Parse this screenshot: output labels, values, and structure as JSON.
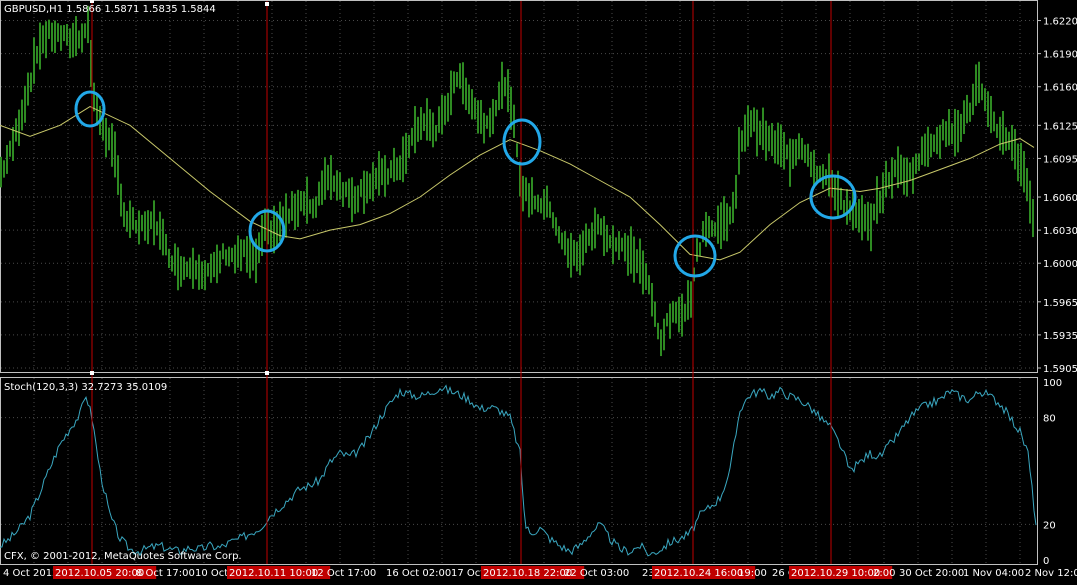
{
  "main_header": "GBPUSD,H1  1.5866 1.5871 1.5835 1.5844",
  "stoch_header": "Stoch(120,3,3) 32.7273 35.0109",
  "copyright": "CFX, © 2001-2012, MetaQuotes Software Corp.",
  "colors": {
    "background": "#000000",
    "grid": "#4a4a4a",
    "border": "#c0c0c0",
    "candle": "#2e8b22",
    "ma": "#c8c86a",
    "stoch": "#3aa7c0",
    "vline": "#c00000",
    "circle": "#22a8e8",
    "label_highlight": "#c00000"
  },
  "chart_data": [
    {
      "type": "line",
      "name": "GBPUSD,H1",
      "y_ticks": [
        "1.6220",
        "1.6190",
        "1.6160",
        "1.6125",
        "1.6095",
        "1.6060",
        "1.6030",
        "1.6000",
        "1.5965",
        "1.5935",
        "1.5905"
      ],
      "ylim": [
        1.5905,
        1.6235
      ],
      "price_path": [
        [
          0,
          1.608
        ],
        [
          10,
          1.61
        ],
        [
          20,
          1.613
        ],
        [
          30,
          1.6165
        ],
        [
          40,
          1.62
        ],
        [
          50,
          1.6208
        ],
        [
          60,
          1.6206
        ],
        [
          70,
          1.6202
        ],
        [
          80,
          1.6206
        ],
        [
          88,
          1.6215
        ],
        [
          95,
          1.614
        ],
        [
          105,
          1.612
        ],
        [
          115,
          1.6095
        ],
        [
          125,
          1.604
        ],
        [
          135,
          1.6035
        ],
        [
          145,
          1.603
        ],
        [
          155,
          1.604
        ],
        [
          165,
          1.6015
        ],
        [
          175,
          1.6
        ],
        [
          185,
          1.5995
        ],
        [
          195,
          1.6
        ],
        [
          205,
          1.599
        ],
        [
          215,
          1.5995
        ],
        [
          225,
          1.601
        ],
        [
          235,
          1.6005
        ],
        [
          245,
          1.601
        ],
        [
          255,
          1.6
        ],
        [
          265,
          1.603
        ],
        [
          275,
          1.603
        ],
        [
          285,
          1.604
        ],
        [
          295,
          1.605
        ],
        [
          305,
          1.606
        ],
        [
          315,
          1.6045
        ],
        [
          325,
          1.608
        ],
        [
          335,
          1.6075
        ],
        [
          345,
          1.6065
        ],
        [
          355,
          1.606
        ],
        [
          365,
          1.607
        ],
        [
          375,
          1.6075
        ],
        [
          385,
          1.608
        ],
        [
          395,
          1.6085
        ],
        [
          405,
          1.6095
        ],
        [
          415,
          1.612
        ],
        [
          425,
          1.613
        ],
        [
          435,
          1.612
        ],
        [
          445,
          1.6135
        ],
        [
          455,
          1.617
        ],
        [
          465,
          1.616
        ],
        [
          475,
          1.614
        ],
        [
          485,
          1.6125
        ],
        [
          495,
          1.614
        ],
        [
          505,
          1.6165
        ],
        [
          515,
          1.612
        ],
        [
          522,
          1.6065
        ],
        [
          530,
          1.606
        ],
        [
          540,
          1.6055
        ],
        [
          550,
          1.605
        ],
        [
          560,
          1.6025
        ],
        [
          570,
          1.6005
        ],
        [
          580,
          1.601
        ],
        [
          590,
          1.6025
        ],
        [
          600,
          1.6035
        ],
        [
          610,
          1.602
        ],
        [
          620,
          1.6015
        ],
        [
          630,
          1.601
        ],
        [
          640,
          1.6
        ],
        [
          650,
          1.5975
        ],
        [
          660,
          1.593
        ],
        [
          670,
          1.595
        ],
        [
          680,
          1.5955
        ],
        [
          690,
          1.5965
        ],
        [
          695,
          1.6
        ],
        [
          705,
          1.6035
        ],
        [
          715,
          1.603
        ],
        [
          725,
          1.604
        ],
        [
          735,
          1.605
        ],
        [
          740,
          1.611
        ],
        [
          750,
          1.613
        ],
        [
          760,
          1.612
        ],
        [
          770,
          1.611
        ],
        [
          780,
          1.6105
        ],
        [
          790,
          1.6095
        ],
        [
          800,
          1.611
        ],
        [
          810,
          1.6095
        ],
        [
          820,
          1.608
        ],
        [
          830,
          1.6075
        ],
        [
          840,
          1.606
        ],
        [
          850,
          1.6045
        ],
        [
          860,
          1.604
        ],
        [
          870,
          1.6035
        ],
        [
          880,
          1.606
        ],
        [
          890,
          1.608
        ],
        [
          900,
          1.6085
        ],
        [
          910,
          1.608
        ],
        [
          920,
          1.6095
        ],
        [
          930,
          1.611
        ],
        [
          940,
          1.6115
        ],
        [
          950,
          1.612
        ],
        [
          960,
          1.6125
        ],
        [
          970,
          1.614
        ],
        [
          978,
          1.6165
        ],
        [
          988,
          1.6135
        ],
        [
          998,
          1.612
        ],
        [
          1008,
          1.6115
        ],
        [
          1018,
          1.6095
        ],
        [
          1026,
          1.608
        ],
        [
          1034,
          1.6035
        ]
      ],
      "ma_path": [
        [
          0,
          1.6125
        ],
        [
          30,
          1.6115
        ],
        [
          60,
          1.6125
        ],
        [
          90,
          1.6142
        ],
        [
          130,
          1.6125
        ],
        [
          170,
          1.6095
        ],
        [
          210,
          1.6065
        ],
        [
          250,
          1.6038
        ],
        [
          280,
          1.6025
        ],
        [
          300,
          1.6022
        ],
        [
          330,
          1.603
        ],
        [
          360,
          1.6035
        ],
        [
          390,
          1.6045
        ],
        [
          420,
          1.606
        ],
        [
          450,
          1.608
        ],
        [
          480,
          1.6098
        ],
        [
          510,
          1.6112
        ],
        [
          540,
          1.6102
        ],
        [
          570,
          1.609
        ],
        [
          600,
          1.6075
        ],
        [
          630,
          1.606
        ],
        [
          660,
          1.6035
        ],
        [
          690,
          1.6008
        ],
        [
          720,
          1.6003
        ],
        [
          740,
          1.601
        ],
        [
          770,
          1.6035
        ],
        [
          800,
          1.6055
        ],
        [
          830,
          1.6068
        ],
        [
          860,
          1.6065
        ],
        [
          880,
          1.6068
        ],
        [
          910,
          1.6075
        ],
        [
          940,
          1.6085
        ],
        [
          970,
          1.6095
        ],
        [
          1000,
          1.6108
        ],
        [
          1020,
          1.6113
        ],
        [
          1034,
          1.6105
        ]
      ]
    },
    {
      "type": "line",
      "name": "Stoch(120,3,3)",
      "y_ticks": [
        "100",
        "80",
        "20",
        "0"
      ],
      "ylim": [
        0,
        100
      ],
      "stoch_path": [
        [
          0,
          8
        ],
        [
          10,
          12
        ],
        [
          20,
          18
        ],
        [
          30,
          25
        ],
        [
          40,
          38
        ],
        [
          50,
          52
        ],
        [
          60,
          65
        ],
        [
          70,
          74
        ],
        [
          80,
          82
        ],
        [
          86,
          93
        ],
        [
          92,
          80
        ],
        [
          100,
          50
        ],
        [
          110,
          25
        ],
        [
          120,
          12
        ],
        [
          130,
          6
        ],
        [
          140,
          5
        ],
        [
          150,
          7
        ],
        [
          160,
          8
        ],
        [
          170,
          6
        ],
        [
          180,
          5
        ],
        [
          190,
          7
        ],
        [
          200,
          6
        ],
        [
          210,
          8
        ],
        [
          220,
          7
        ],
        [
          230,
          10
        ],
        [
          240,
          12
        ],
        [
          250,
          15
        ],
        [
          260,
          18
        ],
        [
          270,
          25
        ],
        [
          280,
          30
        ],
        [
          290,
          35
        ],
        [
          300,
          40
        ],
        [
          310,
          42
        ],
        [
          320,
          45
        ],
        [
          330,
          55
        ],
        [
          340,
          60
        ],
        [
          350,
          58
        ],
        [
          360,
          62
        ],
        [
          370,
          70
        ],
        [
          380,
          80
        ],
        [
          390,
          88
        ],
        [
          400,
          95
        ],
        [
          410,
          93
        ],
        [
          420,
          92
        ],
        [
          430,
          94
        ],
        [
          440,
          97
        ],
        [
          450,
          95
        ],
        [
          460,
          93
        ],
        [
          470,
          90
        ],
        [
          480,
          85
        ],
        [
          490,
          86
        ],
        [
          500,
          84
        ],
        [
          510,
          80
        ],
        [
          520,
          60
        ],
        [
          525,
          20
        ],
        [
          530,
          15
        ],
        [
          540,
          18
        ],
        [
          550,
          12
        ],
        [
          560,
          8
        ],
        [
          570,
          5
        ],
        [
          580,
          8
        ],
        [
          590,
          15
        ],
        [
          600,
          20
        ],
        [
          610,
          12
        ],
        [
          620,
          6
        ],
        [
          630,
          5
        ],
        [
          640,
          8
        ],
        [
          650,
          3
        ],
        [
          660,
          6
        ],
        [
          670,
          10
        ],
        [
          680,
          12
        ],
        [
          690,
          15
        ],
        [
          700,
          25
        ],
        [
          710,
          30
        ],
        [
          720,
          35
        ],
        [
          730,
          50
        ],
        [
          740,
          85
        ],
        [
          750,
          93
        ],
        [
          760,
          95
        ],
        [
          770,
          92
        ],
        [
          780,
          95
        ],
        [
          790,
          92
        ],
        [
          800,
          90
        ],
        [
          810,
          86
        ],
        [
          820,
          80
        ],
        [
          830,
          75
        ],
        [
          840,
          65
        ],
        [
          850,
          50
        ],
        [
          860,
          55
        ],
        [
          870,
          60
        ],
        [
          880,
          58
        ],
        [
          890,
          65
        ],
        [
          900,
          72
        ],
        [
          910,
          80
        ],
        [
          920,
          85
        ],
        [
          930,
          88
        ],
        [
          940,
          90
        ],
        [
          950,
          95
        ],
        [
          960,
          92
        ],
        [
          970,
          90
        ],
        [
          980,
          95
        ],
        [
          990,
          92
        ],
        [
          1000,
          88
        ],
        [
          1010,
          80
        ],
        [
          1020,
          72
        ],
        [
          1028,
          60
        ],
        [
          1036,
          20
        ]
      ],
      "levels": [
        80,
        20
      ]
    }
  ],
  "x_labels": [
    {
      "text": "4 Oct 2012",
      "hl": false
    },
    {
      "text": "2012.10.05 20:00",
      "hl": true
    },
    {
      "text": "8 Oct 17:00",
      "hl": false
    },
    {
      "text": "10 Oct 0",
      "hl": false
    },
    {
      "text": "2012.10.11 10:00",
      "hl": true
    },
    {
      "text": "12 Oct 17:00",
      "hl": false
    },
    {
      "text": "16 Oct 02:00",
      "hl": false
    },
    {
      "text": "17 Oct",
      "hl": false
    },
    {
      "text": "2012.10.18 22:00",
      "hl": true
    },
    {
      "text": "22 Oct 03:00",
      "hl": false
    },
    {
      "text": "23",
      "hl": false
    },
    {
      "text": "2012.10.24 16:00",
      "hl": true
    },
    {
      "text": "19:00",
      "hl": false
    },
    {
      "text": "26 O",
      "hl": false
    },
    {
      "text": "2012.10.29 10:00",
      "hl": true
    },
    {
      "text": "2:00",
      "hl": false
    },
    {
      "text": "30 Oct 20:00",
      "hl": false
    },
    {
      "text": "1 Nov 04:00",
      "hl": false
    },
    {
      "text": "2 Nov 12:00",
      "hl": false
    }
  ]
}
